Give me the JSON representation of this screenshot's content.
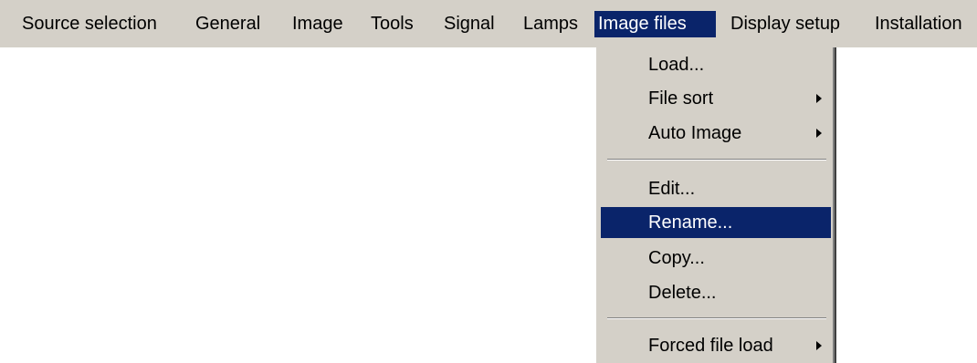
{
  "menubar": {
    "items": [
      {
        "label": "Source selection"
      },
      {
        "label": "General"
      },
      {
        "label": "Image"
      },
      {
        "label": "Tools"
      },
      {
        "label": "Signal"
      },
      {
        "label": "Lamps"
      },
      {
        "label": "Image files",
        "active": true
      },
      {
        "label": "Display setup"
      },
      {
        "label": "Installation"
      }
    ]
  },
  "dropdown": {
    "items": [
      {
        "label": "Load..."
      },
      {
        "label": "File sort",
        "submenu": true
      },
      {
        "label": "Auto Image",
        "submenu": true
      },
      {
        "label": "Edit..."
      },
      {
        "label": "Rename...",
        "highlighted": true
      },
      {
        "label": "Copy..."
      },
      {
        "label": "Delete..."
      },
      {
        "label": "Forced file load",
        "submenu": true
      }
    ]
  },
  "colors": {
    "menu_background": "#d4d0c8",
    "highlight": "#0a246a",
    "highlight_text": "#ffffff",
    "text": "#000000"
  },
  "icons": {
    "submenu_arrow": "triangle-right-icon"
  }
}
